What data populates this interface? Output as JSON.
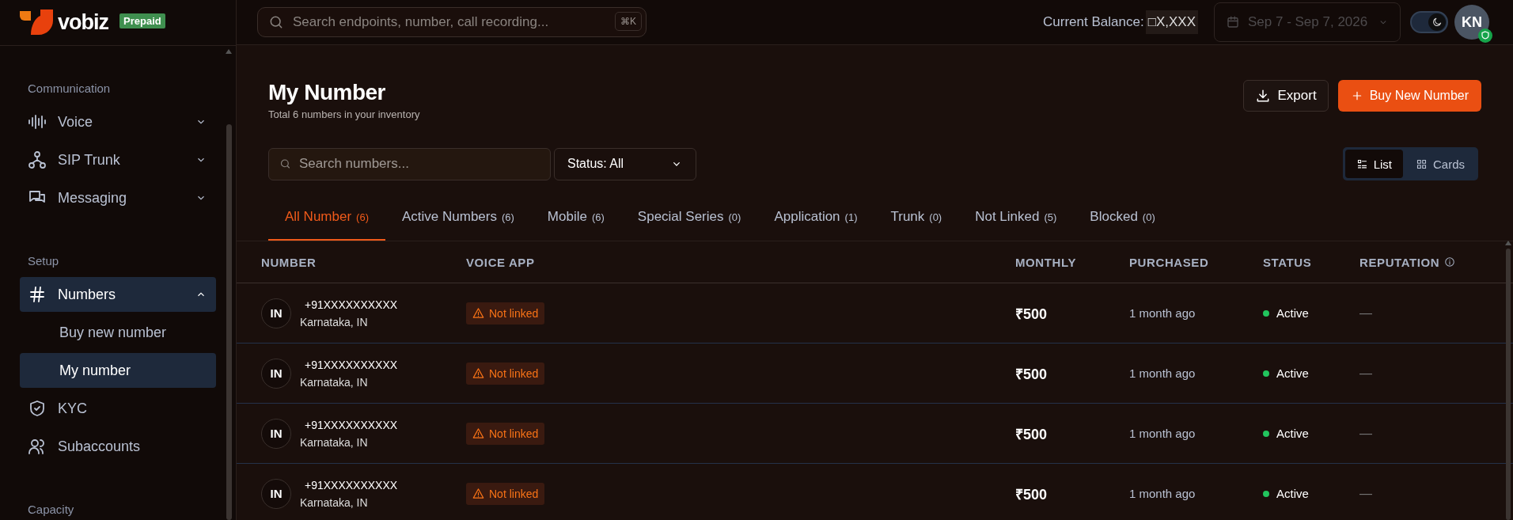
{
  "sidebar": {
    "logo": {
      "name": "vobiz",
      "badge": "Prepaid"
    },
    "sections": [
      {
        "title": "Communication",
        "items": [
          {
            "label": "Voice",
            "expanded": false,
            "selected": false
          },
          {
            "label": "SIP Trunk",
            "expanded": false,
            "selected": false
          },
          {
            "label": "Messaging",
            "expanded": false,
            "selected": false
          }
        ]
      },
      {
        "title": "Setup",
        "items": [
          {
            "label": "Numbers",
            "expanded": true,
            "selected": true,
            "children": [
              {
                "label": "Buy new number",
                "selected": false
              },
              {
                "label": "My number",
                "selected": true
              }
            ]
          },
          {
            "label": "KYC",
            "selected": false
          },
          {
            "label": "Subaccounts",
            "selected": false
          }
        ]
      },
      {
        "title": "Capacity"
      }
    ]
  },
  "header": {
    "search": {
      "placeholder": "Search endpoints, number, call recording...",
      "shortcut": "⌘K"
    },
    "balance_label": "Current Balance:",
    "balance_value": "□X,XXX",
    "date_range": {
      "value": "Sep 7 - Sep 7, 2026",
      "disabled": true
    },
    "dark_mode": {
      "on": true
    },
    "avatar": "KN"
  },
  "page": {
    "title": "My Number",
    "subtitle": "Total 6 numbers in your inventory",
    "buttons": [
      {
        "label": "Export",
        "kind": "secondary"
      },
      {
        "label": "Buy New Number",
        "kind": "primary"
      }
    ],
    "search": {
      "placeholder": "Search numbers..."
    },
    "status_filter": "Status: All",
    "views": [
      {
        "label": "List",
        "selected": true
      },
      {
        "label": "Cards",
        "selected": false
      }
    ],
    "tabs": [
      {
        "label": "All Number",
        "count": "(6)",
        "selected": true
      },
      {
        "label": "Active Numbers",
        "count": "(6)",
        "selected": false
      },
      {
        "label": "Mobile",
        "count": "(6)",
        "selected": false
      },
      {
        "label": "Special Series",
        "count": "(0)",
        "selected": false
      },
      {
        "label": "Application",
        "count": "(1)",
        "selected": false
      },
      {
        "label": "Trunk",
        "count": "(0)",
        "selected": false
      },
      {
        "label": "Not Linked",
        "count": "(5)",
        "selected": false
      },
      {
        "label": "Blocked",
        "count": "(0)",
        "selected": false
      }
    ]
  },
  "table": {
    "columns": [
      "NUMBER",
      "VOICE APP",
      "MONTHLY",
      "PURCHASED",
      "STATUS",
      "REPUTATION"
    ],
    "rows": [
      {
        "country": "IN",
        "number": "+91XXXXXXXXXX",
        "location": "Karnataka, IN",
        "voice_app": "Not linked",
        "monthly": "₹500",
        "purchased": "1 month ago",
        "status": "Active",
        "reputation": "—"
      },
      {
        "country": "IN",
        "number": "+91XXXXXXXXXX",
        "location": "Karnataka, IN",
        "voice_app": "Not linked",
        "monthly": "₹500",
        "purchased": "1 month ago",
        "status": "Active",
        "reputation": "—"
      },
      {
        "country": "IN",
        "number": "+91XXXXXXXXXX",
        "location": "Karnataka, IN",
        "voice_app": "Not linked",
        "monthly": "₹500",
        "purchased": "1 month ago",
        "status": "Active",
        "reputation": "—"
      },
      {
        "country": "IN",
        "number": "+91XXXXXXXXXX",
        "location": "Karnataka, IN",
        "voice_app": "Not linked",
        "monthly": "₹500",
        "purchased": "1 month ago",
        "status": "Active",
        "reputation": "—"
      }
    ]
  }
}
